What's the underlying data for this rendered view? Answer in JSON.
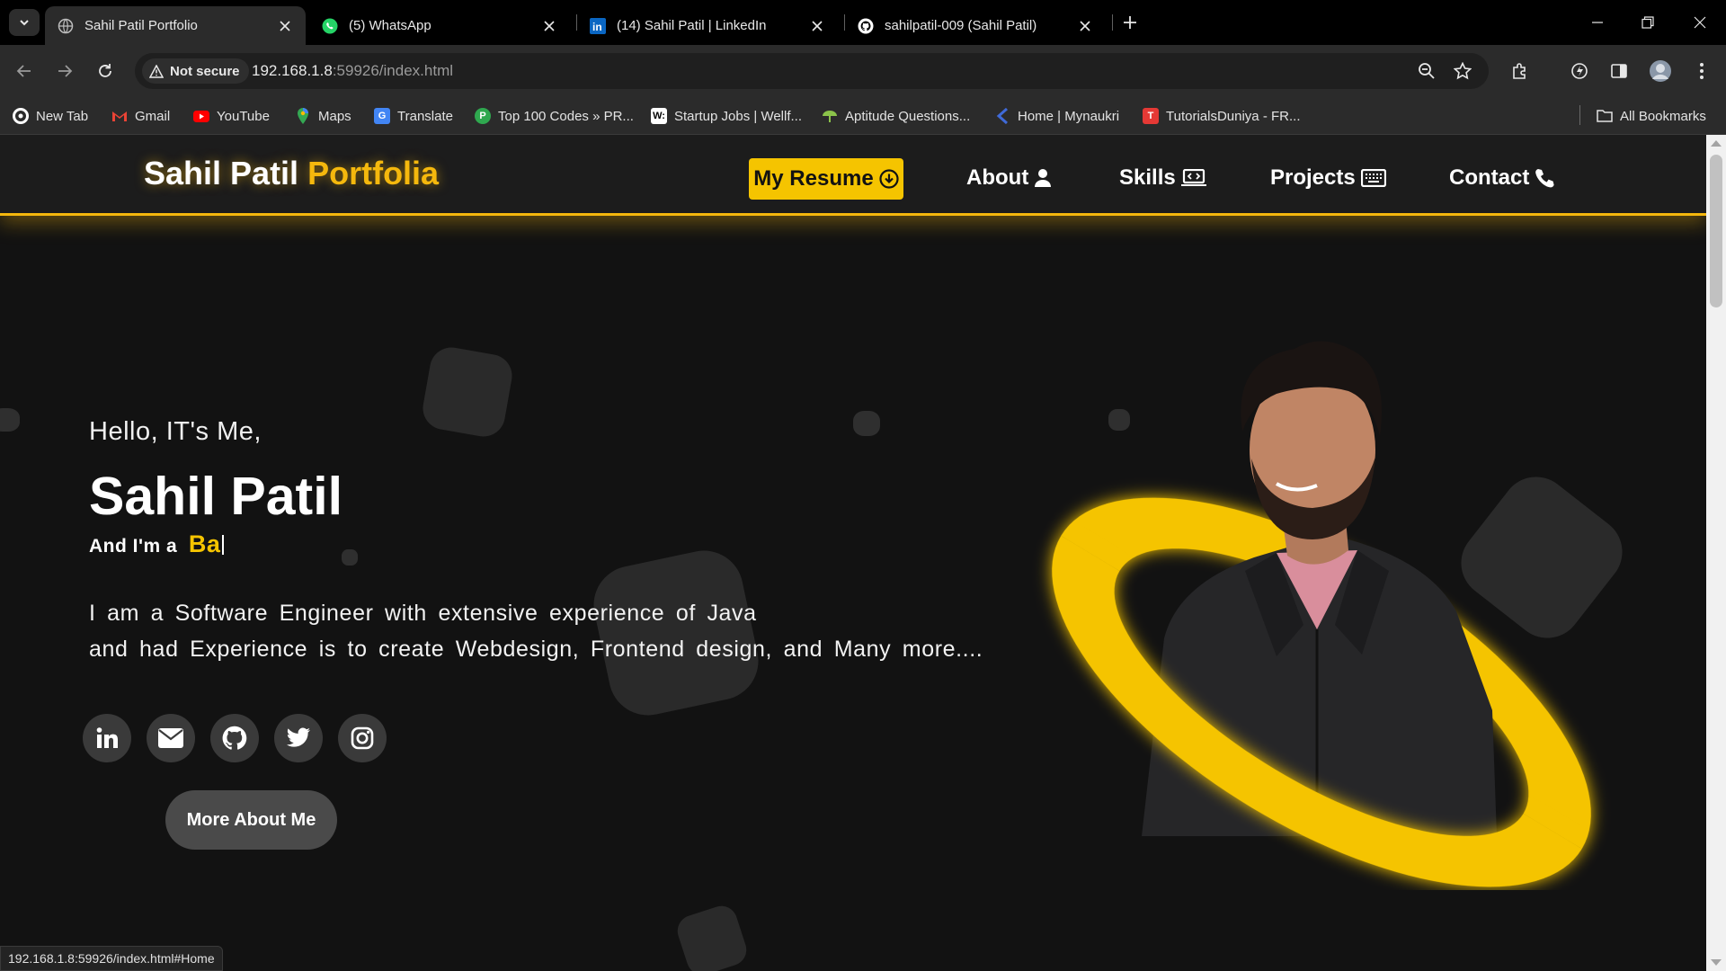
{
  "browser": {
    "tabs": [
      {
        "title": "Sahil Patil Portfolio",
        "active": true,
        "favicon": "globe-icon"
      },
      {
        "title": "(5) WhatsApp",
        "active": false,
        "favicon": "whatsapp-icon"
      },
      {
        "title": "(14) Sahil Patil | LinkedIn",
        "active": false,
        "favicon": "linkedin-icon"
      },
      {
        "title": "sahilpatil-009 (Sahil Patil)",
        "active": false,
        "favicon": "github-icon"
      }
    ],
    "security_label": "Not secure",
    "url_host": "192.168.1.8",
    "url_rest": ":59926/index.html",
    "bookmarks": [
      {
        "label": "New Tab",
        "icon": "chrome-icon",
        "color": "#ffffff"
      },
      {
        "label": "Gmail",
        "icon": "gmail-icon",
        "color": "#ea4335"
      },
      {
        "label": "YouTube",
        "icon": "youtube-icon",
        "color": "#ff0000"
      },
      {
        "label": "Maps",
        "icon": "maps-icon",
        "color": "#34a853"
      },
      {
        "label": "Translate",
        "icon": "translate-icon",
        "color": "#4285f4"
      },
      {
        "label": "Top 100 Codes » PR...",
        "icon": "codes-icon",
        "color": "#2fa84f"
      },
      {
        "label": "Startup Jobs | Wellf...",
        "icon": "wellfound-icon",
        "color": "#ffffff"
      },
      {
        "label": "Aptitude Questions...",
        "icon": "aptitude-icon",
        "color": "#8bc34a"
      },
      {
        "label": "Home | Mynaukri",
        "icon": "mynaukri-icon",
        "color": "#3f6ad8"
      },
      {
        "label": "TutorialsDuniya - FR...",
        "icon": "tutorialsduniya-icon",
        "color": "#e53935"
      }
    ],
    "all_bookmarks": "All Bookmarks",
    "status_url": "192.168.1.8:59926/index.html#Home"
  },
  "site": {
    "logo_main": "Sahil Patil",
    "logo_accent": "Portfolia",
    "nav": {
      "resume": "My Resume",
      "about": "About",
      "skills": "Skills",
      "projects": "Projects",
      "contact": "Contact"
    },
    "hero": {
      "greeting": "Hello, IT's Me,",
      "name": "Sahil Patil",
      "role_prefix": "And I'm a",
      "role_typed": "Ba",
      "bio_line1": "I am a Software Engineer with extensive experience of Java",
      "bio_line2": "and had Experience is to create Webdesign, Frontend design, and Many more....",
      "cta": "More About Me",
      "socials": [
        "linkedin-icon",
        "mail-icon",
        "github-icon",
        "twitter-icon",
        "instagram-icon"
      ]
    },
    "colors": {
      "accent": "#f5c400",
      "background": "#121212",
      "nav_bg": "#1c1c1c"
    }
  }
}
